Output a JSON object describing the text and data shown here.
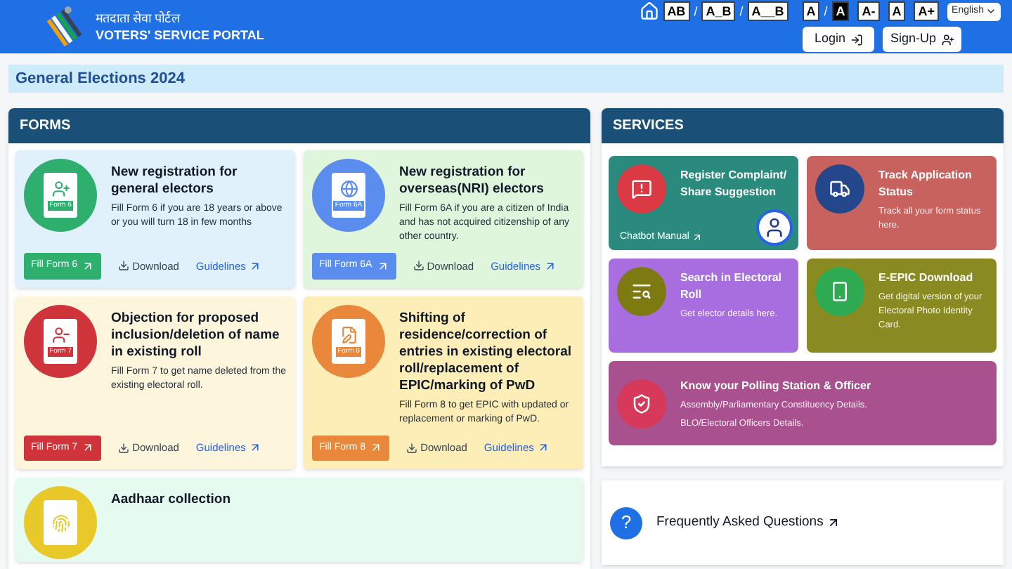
{
  "header": {
    "title_hindi": "मतदाता सेवा पोर्टल",
    "title": "VOTERS' SERVICE PORTAL",
    "separator": "/",
    "text_spacing": [
      "AB",
      "A_B",
      "A__B"
    ],
    "contrast": [
      {
        "label": "A",
        "selected": false
      },
      {
        "label": "A",
        "selected": true
      }
    ],
    "font_size": [
      "A-",
      "A",
      "A+"
    ],
    "language": "English",
    "login": "Login",
    "signup": "Sign-Up"
  },
  "banner": "General Elections 2024",
  "forms": {
    "title": "FORMS",
    "items": [
      {
        "kind": "add",
        "badge": "Form 6",
        "title": "New registration for general electors",
        "description": "Fill Form 6 if you are 18 years or above or you will turn 18 in few months",
        "fill": "Fill Form 6",
        "download": "Download",
        "guidelines": "Guidelines",
        "color": "#2eaf6e",
        "card": {
          "color": "#e1f1fb"
        }
      },
      {
        "kind": "overseas",
        "badge": "Form 6A",
        "title": "New registration for overseas(NRI) electors",
        "description": "Fill Form 6A if you are a citizen of India and has not acquired citizenship of any other country.",
        "fill": "Fill Form 6A",
        "download": "Download",
        "guidelines": "Guidelines",
        "color": "#5b8def",
        "card": {
          "color": "#dff5dc"
        }
      },
      {
        "kind": "delete",
        "badge": "Form 7",
        "title": "Objection for proposed inclusion/deletion of name in existing roll",
        "description": "Fill Form 7 to get name deleted from the existing electoral roll.",
        "fill": "Fill Form 7",
        "download": "Download",
        "guidelines": "Guidelines",
        "color": "#d0343b",
        "card": {
          "color": "#fdf6dc"
        }
      },
      {
        "kind": "edit",
        "badge": "Form 8",
        "title": "Shifting of residence/correction of entries in existing electoral roll/replacement of EPIC/marking of PwD",
        "description": "Fill Form 8 to get EPIC with updated or replacement or marking of PwD.",
        "fill": "Fill Form 8",
        "download": "Download",
        "guidelines": "Guidelines",
        "color": "#e9883a",
        "card": {
          "color": "#fdeeb8"
        }
      },
      {
        "kind": "aadhaar",
        "title": "Aadhaar collection",
        "color": "#e9c92a",
        "card": {
          "color": "#e6fbef"
        }
      }
    ]
  },
  "services": {
    "title": "SERVICES",
    "items": [
      {
        "kind": "complaint",
        "title": "Register Complaint/ Share Suggestion",
        "link": "Chatbot Manual",
        "color": "#2a8a7e",
        "icon": {
          "color": "#db3a44"
        }
      },
      {
        "kind": "track",
        "title": "Track Application Status",
        "description": "Track all your form status here.",
        "color": "#c7625f",
        "icon": {
          "color": "#24468a"
        }
      },
      {
        "kind": "search",
        "title": "Search in Electoral Roll",
        "description": "Get elector details here.",
        "color": "#a86ee0",
        "icon": {
          "color": "#7e7a12"
        }
      },
      {
        "kind": "epic",
        "title": "E-EPIC Download",
        "description": "Get digital version of your Electoral Photo Identity Card.",
        "color": "#8a8a22",
        "icon": {
          "color": "#2eaa52"
        }
      },
      {
        "kind": "polling",
        "title": "Know your Polling Station & Officer",
        "lines": [
          "Assembly/Parliamentary Constituency Details.",
          "BLO/Electoral Officers Details."
        ],
        "color": "#a9508f",
        "icon": {
          "color": "#d6395a"
        }
      }
    ]
  },
  "faq": {
    "icon": "?",
    "label": "Frequently Asked Questions"
  }
}
